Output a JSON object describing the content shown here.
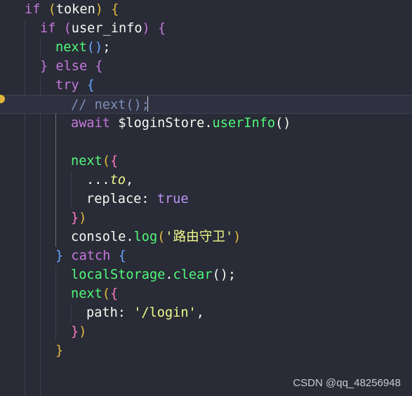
{
  "colors": {
    "background": "#292b36",
    "keyword": "#c678dd",
    "function": "#50fa7b",
    "string": "#f1fa8c",
    "comment": "#7f8eb9",
    "bracket_gold": "#e3bb3e",
    "bracket_purple": "#c678dd",
    "bracket_blue": "#62a8ff",
    "bracket_pink": "#ff79c6"
  },
  "lines": [
    {
      "tokens": [
        [
          "if",
          "kw"
        ],
        [
          " ",
          "var"
        ],
        [
          "(",
          "pa"
        ],
        [
          "token",
          "var"
        ],
        [
          ")",
          "pa"
        ],
        [
          " ",
          "var"
        ],
        [
          "{",
          "pa"
        ]
      ]
    },
    {
      "tokens": [
        [
          "if",
          "kw"
        ],
        [
          " ",
          "var"
        ],
        [
          "(",
          "pb"
        ],
        [
          "user_info",
          "var"
        ],
        [
          ")",
          "pb"
        ],
        [
          " ",
          "var"
        ],
        [
          "{",
          "pb"
        ]
      ]
    },
    {
      "tokens": [
        [
          "next",
          "fn"
        ],
        [
          "(",
          "pc"
        ],
        [
          ")",
          "pc"
        ],
        [
          ";",
          "op"
        ]
      ]
    },
    {
      "tokens": [
        [
          "}",
          "pb"
        ],
        [
          " ",
          "var"
        ],
        [
          "else",
          "kw"
        ],
        [
          " ",
          "var"
        ],
        [
          "{",
          "pb"
        ]
      ]
    },
    {
      "tokens": [
        [
          "try",
          "kw"
        ],
        [
          " ",
          "var"
        ],
        [
          "{",
          "pc"
        ]
      ]
    },
    {
      "tokens": [
        [
          "// next();",
          "cm"
        ]
      ]
    },
    {
      "tokens": [
        [
          "await",
          "kw"
        ],
        [
          " ",
          "var"
        ],
        [
          "$loginStore",
          "var"
        ],
        [
          ".",
          "op"
        ],
        [
          "userInfo",
          "fn"
        ],
        [
          "()",
          "var"
        ]
      ]
    },
    {
      "tokens": []
    },
    {
      "tokens": [
        [
          "next",
          "fn"
        ],
        [
          "(",
          "pa"
        ],
        [
          "{",
          "br1"
        ]
      ]
    },
    {
      "tokens": [
        [
          "...",
          "op"
        ],
        [
          "to",
          "it"
        ],
        [
          ",",
          "op"
        ]
      ]
    },
    {
      "tokens": [
        [
          "replace",
          "prop"
        ],
        [
          ":",
          "op"
        ],
        [
          " ",
          "var"
        ],
        [
          "true",
          "bool"
        ]
      ]
    },
    {
      "tokens": [
        [
          "}",
          "br1"
        ],
        [
          ")",
          "pa"
        ]
      ]
    },
    {
      "tokens": [
        [
          "console",
          "var"
        ],
        [
          ".",
          "op"
        ],
        [
          "log",
          "fn"
        ],
        [
          "(",
          "pa"
        ],
        [
          "'路由守卫'",
          "str"
        ],
        [
          ")",
          "pa"
        ]
      ]
    },
    {
      "tokens": [
        [
          "}",
          "pc"
        ],
        [
          " ",
          "var"
        ],
        [
          "catch",
          "kw"
        ],
        [
          " ",
          "var"
        ],
        [
          "{",
          "pc"
        ]
      ]
    },
    {
      "tokens": [
        [
          "localStorage",
          "fn"
        ],
        [
          ".",
          "op"
        ],
        [
          "clear",
          "fn"
        ],
        [
          "()",
          "var"
        ],
        [
          ";",
          "op"
        ]
      ]
    },
    {
      "tokens": [
        [
          "next",
          "fn"
        ],
        [
          "(",
          "pa"
        ],
        [
          "{",
          "br1"
        ]
      ]
    },
    {
      "tokens": [
        [
          "path",
          "prop"
        ],
        [
          ":",
          "op"
        ],
        [
          " ",
          "var"
        ],
        [
          "'/login'",
          "str"
        ],
        [
          ",",
          "op"
        ]
      ]
    },
    {
      "tokens": [
        [
          "}",
          "br1"
        ],
        [
          ")",
          "pa"
        ]
      ]
    },
    {
      "tokens": [
        [
          "}",
          "pa"
        ]
      ]
    }
  ],
  "watermark": "CSDN @qq_48256948"
}
